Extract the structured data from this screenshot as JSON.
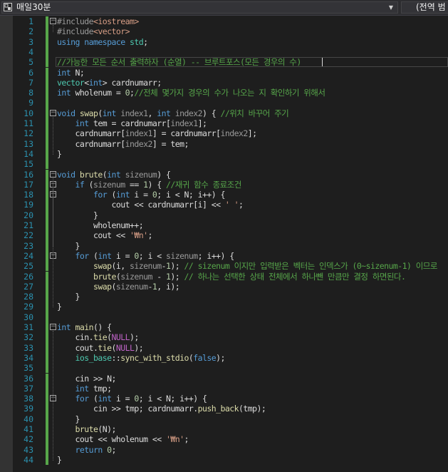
{
  "navbar": {
    "project_name": "매일30분",
    "scope": "(전역 범"
  },
  "editor": {
    "lines": [
      {
        "n": "1",
        "code": "<span class=\"pp\">#include</span><span class=\"inc\">&lt;iostream&gt;</span>"
      },
      {
        "n": "2",
        "code": "<span class=\"pp\">#include</span><span class=\"inc\">&lt;vector&gt;</span>"
      },
      {
        "n": "3",
        "code": "<span class=\"kw\">using namespace</span> <span class=\"ty\">std</span>;"
      },
      {
        "n": "4",
        "code": ""
      },
      {
        "n": "5",
        "code": "<span class=\"cm\">//가능한 모든 순서 출력하자 (순열) -- 브루트포스(모든 경우의 수)</span>"
      },
      {
        "n": "6",
        "code": "<span class=\"kw\">int</span> N;"
      },
      {
        "n": "7",
        "code": "<span class=\"ty\">vector</span>&lt;<span class=\"kw\">int</span>&gt; cardnumarr;"
      },
      {
        "n": "8",
        "code": "<span class=\"kw\">int</span> wholenum = <span class=\"num\">0</span>;<span class=\"cm\">//전체 몇가지 경우의 수가 나오는 지 확인하기 위해서</span>"
      },
      {
        "n": "9",
        "code": ""
      },
      {
        "n": "10",
        "code": "<span class=\"kw\">void</span> <span class=\"fn\">swap</span>(<span class=\"kw\">int</span> <span class=\"par\">index1</span>, <span class=\"kw\">int</span> <span class=\"par\">index2</span>) { <span class=\"cm\">//위치 바꾸어 주기</span>"
      },
      {
        "n": "11",
        "code": "    <span class=\"kw\">int</span> tem = cardnumarr[<span class=\"par\">index1</span>];"
      },
      {
        "n": "12",
        "code": "    cardnumarr[<span class=\"par\">index1</span>] = cardnumarr[<span class=\"par\">index2</span>];"
      },
      {
        "n": "13",
        "code": "    cardnumarr[<span class=\"par\">index2</span>] = tem;"
      },
      {
        "n": "14",
        "code": "}"
      },
      {
        "n": "15",
        "code": ""
      },
      {
        "n": "16",
        "code": "<span class=\"kw\">void</span> <span class=\"fn\">brute</span>(<span class=\"kw\">int</span> <span class=\"par\">sizenum</span>) {"
      },
      {
        "n": "17",
        "code": "    <span class=\"kw\">if</span> (<span class=\"par\">sizenum</span> == <span class=\"num\">1</span>) { <span class=\"cm\">//재귀 함수 종료조건</span>"
      },
      {
        "n": "18",
        "code": "        <span class=\"kw\">for</span> (<span class=\"kw\">int</span> i = <span class=\"num\">0</span>; i &lt; N; i++) {"
      },
      {
        "n": "19",
        "code": "            cout &lt;&lt; cardnumarr[i] &lt;&lt; <span class=\"str\">' '</span>;"
      },
      {
        "n": "20",
        "code": "        }"
      },
      {
        "n": "21",
        "code": "        wholenum++;"
      },
      {
        "n": "22",
        "code": "        cout &lt;&lt; <span class=\"str\">'₩n'</span>;"
      },
      {
        "n": "23",
        "code": "    }"
      },
      {
        "n": "24",
        "code": "    <span class=\"kw\">for</span> (<span class=\"kw\">int</span> i = <span class=\"num\">0</span>; i &lt; <span class=\"par\">sizenum</span>; i++) {"
      },
      {
        "n": "25",
        "code": "        <span class=\"fn\">swap</span>(i, <span class=\"par\">sizenum</span>-<span class=\"num\">1</span>); <span class=\"cm\">// sizenum 이지만 입력받은 벡터는 인덱스가 (0~sizenum-1) 이므로</span>"
      },
      {
        "n": "26",
        "code": "        <span class=\"fn\">brute</span>(<span class=\"par\">sizenum</span> - <span class=\"num\">1</span>); <span class=\"cm\">// 하나는 선택한 상태 전체에서 하나뺀 만큼만 결정 하면된다.</span>"
      },
      {
        "n": "27",
        "code": "        <span class=\"fn\">swap</span>(<span class=\"par\">sizenum</span>-<span class=\"num\">1</span>, i);"
      },
      {
        "n": "28",
        "code": "    }"
      },
      {
        "n": "29",
        "code": "}"
      },
      {
        "n": "30",
        "code": ""
      },
      {
        "n": "31",
        "code": "<span class=\"kw\">int</span> <span class=\"fn\">main</span>() {"
      },
      {
        "n": "32",
        "code": "    cin.<span class=\"fn\">tie</span>(<span class=\"mac\">NULL</span>);"
      },
      {
        "n": "33",
        "code": "    cout.<span class=\"fn\">tie</span>(<span class=\"mac\">NULL</span>);"
      },
      {
        "n": "34",
        "code": "    <span class=\"ty\">ios_base</span>::<span class=\"fn\">sync_with_stdio</span>(<span class=\"kw\">false</span>);"
      },
      {
        "n": "35",
        "code": ""
      },
      {
        "n": "36",
        "code": "    cin &gt;&gt; N;"
      },
      {
        "n": "37",
        "code": "    <span class=\"kw\">int</span> tmp;"
      },
      {
        "n": "38",
        "code": "    <span class=\"kw\">for</span> (<span class=\"kw\">int</span> i = <span class=\"num\">0</span>; i &lt; N; i++) {"
      },
      {
        "n": "39",
        "code": "        cin &gt;&gt; tmp; cardnumarr.<span class=\"fn\">push_back</span>(tmp);"
      },
      {
        "n": "40",
        "code": "    }"
      },
      {
        "n": "41",
        "code": "    <span class=\"fn\">brute</span>(N);"
      },
      {
        "n": "42",
        "code": "    cout &lt;&lt; wholenum &lt;&lt; <span class=\"str\">'₩n'</span>;"
      },
      {
        "n": "43",
        "code": "    <span class=\"kw\">return</span> <span class=\"num\">0</span>;"
      },
      {
        "n": "44",
        "code": "}"
      }
    ]
  }
}
